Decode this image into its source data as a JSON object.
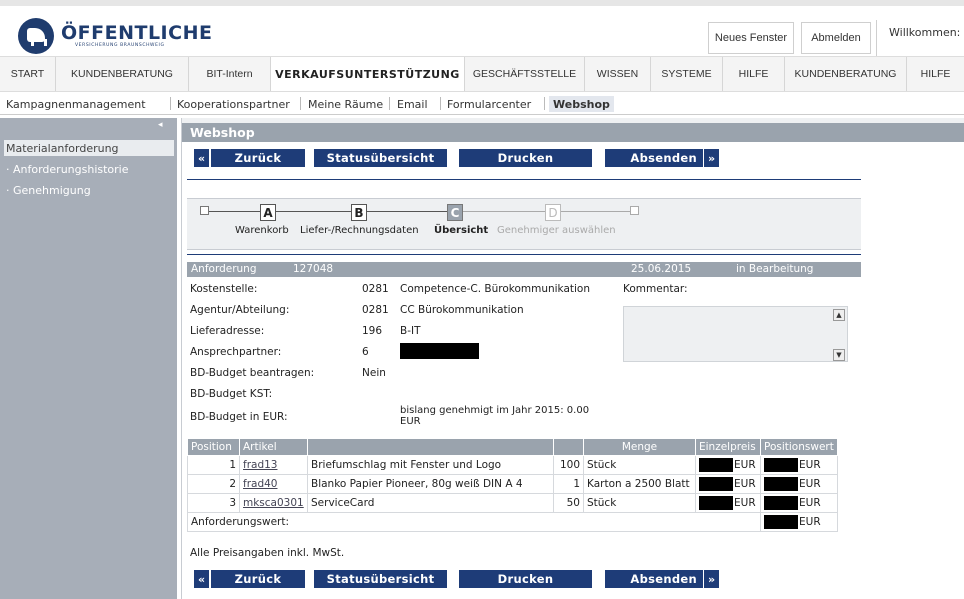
{
  "header": {
    "logo_title": "ÖFFENTLICHE",
    "logo_subtitle": "VERSICHERUNG BRAUNSCHWEIG",
    "btn_new_window": "Neues Fenster",
    "btn_logout": "Abmelden",
    "welcome": "Willkommen:"
  },
  "mainnav": [
    "START",
    "KUNDENBERATUNG",
    "BIT-Intern",
    "VERKAUFSUNTERSTÜTZUNG",
    "GESCHÄFTSSTELLE",
    "WISSEN",
    "SYSTEME",
    "HILFE",
    "KUNDENBERATUNG",
    "HILFE"
  ],
  "subnav": [
    "Kampagnenmanagement",
    "Kooperationspartner",
    "Meine Räume",
    "Email",
    "Formularcenter",
    "Webshop"
  ],
  "sidebar": {
    "collapse_glyph": "◂",
    "items": [
      "Materialanforderung",
      "· Anforderungshistorie",
      "· Genehmigung"
    ]
  },
  "frame": {
    "title": "Webshop",
    "buttons": {
      "back": "Zurück",
      "status": "Statusübersicht",
      "print": "Drucken",
      "send": "Absenden",
      "prev_arrow": "«",
      "next_arrow": "»"
    }
  },
  "stepper": {
    "steps": [
      {
        "letter": "A",
        "label": "Warenkorb"
      },
      {
        "letter": "B",
        "label": "Liefer-/Rechnungsdaten"
      },
      {
        "letter": "C",
        "label": "Übersicht"
      },
      {
        "letter": "D",
        "label": "Genehmiger auswählen"
      }
    ]
  },
  "request": {
    "label": "Anforderung",
    "number": "127048",
    "date": "25.06.2015",
    "status": "in Bearbeitung",
    "fields": [
      {
        "label": "Kostenstelle:",
        "code": "0281",
        "value": "Competence-C. Bürokommunikation"
      },
      {
        "label": "Agentur/Abteilung:",
        "code": "0281",
        "value": "CC Bürokommunikation"
      },
      {
        "label": "Lieferadresse:",
        "code": "196",
        "value": "B-IT"
      },
      {
        "label": "Ansprechpartner:",
        "code": "6",
        "value": ""
      },
      {
        "label": "BD-Budget beantragen:",
        "code": "Nein",
        "value": ""
      },
      {
        "label": "BD-Budget KST:",
        "code": "",
        "value": ""
      },
      {
        "label": "BD-Budget in EUR:",
        "code": "",
        "value": "bislang genehmigt im Jahr 2015: 0.00"
      }
    ],
    "budget_eur_line2": "EUR",
    "comment_label": "Kommentar:"
  },
  "table": {
    "headers": [
      "Position",
      "Artikel",
      "",
      "Menge",
      "",
      "Einzelpreis",
      "Positionswert"
    ],
    "rows": [
      {
        "pos": "1",
        "code": "frad13",
        "desc": "Briefumschlag mit Fenster und Logo",
        "qty": "100",
        "unit": "Stück",
        "currency": "EUR"
      },
      {
        "pos": "2",
        "code": "frad40",
        "desc": "Blanko Papier Pioneer, 80g weiß DIN A 4",
        "qty": "1",
        "unit": "Karton a 2500 Blatt",
        "currency": "EUR"
      },
      {
        "pos": "3",
        "code": "mksca0301",
        "desc": "ServiceCard",
        "qty": "50",
        "unit": "Stück",
        "currency": "EUR"
      }
    ],
    "total_label": "Anforderungswert:",
    "total_currency": "EUR",
    "note": "Alle Preisangaben inkl. MwSt."
  }
}
